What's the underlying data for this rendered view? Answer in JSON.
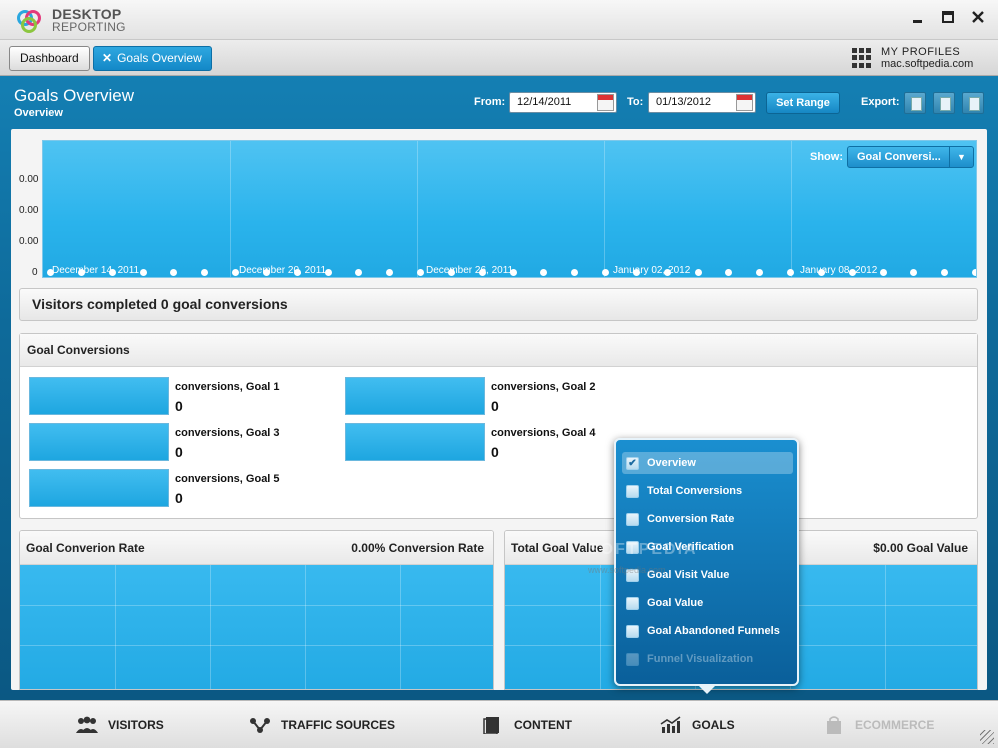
{
  "app": {
    "logo_line1": "DESKTOP",
    "logo_line2": "REPORTING",
    "minimize": "🗕",
    "maximize": "◻",
    "close": "✕"
  },
  "nav": {
    "dashboard_label": "Dashboard",
    "active_tab_label": "Goals Overview",
    "profiles_label": "MY PROFILES",
    "profile_site": "mac.softpedia.com"
  },
  "header": {
    "title": "Goals Overview",
    "subtitle": "Overview",
    "from_label": "From:",
    "from_value": "12/14/2011",
    "to_label": "To:",
    "to_value": "01/13/2012",
    "set_range_label": "Set Range",
    "export_label": "Export:"
  },
  "chart": {
    "show_label": "Show:",
    "show_value": "Goal Conversi...",
    "y_ticks": [
      "0.00",
      "0.00",
      "0.00",
      "0"
    ],
    "x_labels": [
      "December 14, 2011",
      "December 20, 2011",
      "December 26, 2011",
      "January 02, 2012",
      "January 08, 2012"
    ]
  },
  "chart_data": {
    "type": "area",
    "x": [
      "December 14, 2011",
      "December 20, 2011",
      "December 26, 2011",
      "January 02, 2012",
      "January 08, 2012"
    ],
    "y_ticks": [
      "0.00",
      "0.00",
      "0.00",
      "0"
    ],
    "values": [
      0,
      0,
      0,
      0,
      0
    ],
    "title": "",
    "xlabel": "",
    "ylabel": ""
  },
  "summary_text": "Visitors completed 0 goal conversions",
  "goal_conversions": {
    "title": "Goal Conversions",
    "goals": [
      {
        "name": "conversions, Goal 1",
        "value": "0"
      },
      {
        "name": "conversions, Goal 2",
        "value": "0"
      },
      {
        "name": "conversions, Goal 3",
        "value": "0"
      },
      {
        "name": "conversions, Goal 4",
        "value": "0"
      },
      {
        "name": "conversions, Goal 5",
        "value": "0"
      }
    ]
  },
  "cards": {
    "rate_title": "Goal Converion Rate",
    "rate_value": "0.00% Conversion Rate",
    "value_title": "Total Goal Value",
    "value_value": "$0.00 Goal Value"
  },
  "menu": {
    "items": [
      {
        "label": "Overview",
        "checked": true
      },
      {
        "label": "Total Conversions",
        "checked": false
      },
      {
        "label": "Conversion Rate",
        "checked": false
      },
      {
        "label": "Goal Verification",
        "checked": false
      },
      {
        "label": "Goal Visit Value",
        "checked": false
      },
      {
        "label": "Goal Value",
        "checked": false
      },
      {
        "label": "Goal Abandoned Funnels",
        "checked": false
      },
      {
        "label": "Funnel Visualization",
        "checked": false
      }
    ],
    "watermark": "SOFTPEDIA",
    "watermark_url": "www.softpedia.com"
  },
  "bottom_tabs": {
    "visitors": "VISITORS",
    "traffic": "TRAFFIC SOURCES",
    "content": "CONTENT",
    "goals": "GOALS",
    "ecommerce": "ECOMMERCE"
  },
  "colors": {
    "accent": "#1388c7",
    "chart_fill": "#2ab3ec",
    "header_bg": "#0e6a9a"
  }
}
